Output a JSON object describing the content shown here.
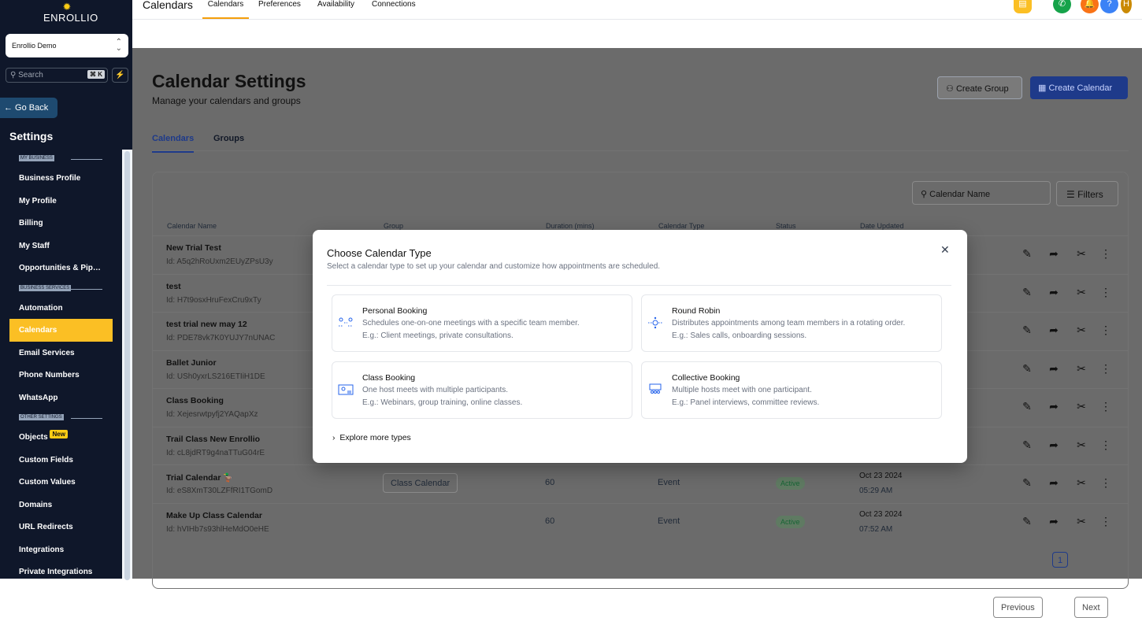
{
  "sidebar": {
    "brand": "ENROLLIO",
    "account": "Enrollio Demo",
    "search_placeholder": "Search",
    "search_kbd": "⌘ K",
    "go_back": "← Go Back",
    "title": "Settings",
    "sections": [
      {
        "label": "MY BUSINESS",
        "items": [
          {
            "label": "Business Profile"
          },
          {
            "label": "My Profile"
          },
          {
            "label": "Billing"
          },
          {
            "label": "My Staff"
          },
          {
            "label": "Opportunities & Pipe..."
          }
        ]
      },
      {
        "label": "BUSINESS SERVICES",
        "items": [
          {
            "label": "Automation"
          },
          {
            "label": "Calendars",
            "active": true
          },
          {
            "label": "Email Services"
          },
          {
            "label": "Phone Numbers"
          },
          {
            "label": "WhatsApp"
          }
        ]
      },
      {
        "label": "OTHER SETTINGS",
        "items": [
          {
            "label": "Objects",
            "badge": "New"
          },
          {
            "label": "Custom Fields"
          },
          {
            "label": "Custom Values"
          },
          {
            "label": "Domains"
          },
          {
            "label": "URL Redirects"
          },
          {
            "label": "Integrations"
          },
          {
            "label": "Private Integrations"
          }
        ]
      }
    ]
  },
  "topbar": {
    "title": "Calendars",
    "tabs": [
      "Calendars",
      "Preferences",
      "Availability",
      "Connections"
    ],
    "active_tab": "Calendars"
  },
  "page": {
    "title": "Calendar Settings",
    "subtitle": "Manage your calendars and groups",
    "create_group": "Create Group",
    "create_calendar": "Create Calendar",
    "tabs": [
      "Calendars",
      "Groups"
    ],
    "search_placeholder": "Calendar Name",
    "filters": "Filters"
  },
  "table": {
    "columns": [
      "Calendar Name",
      "Group",
      "Duration (mins)",
      "Calendar Type",
      "Status",
      "Date Updated"
    ],
    "rows": [
      {
        "name": "New Trial Test",
        "id": "Id: A5q2hRoUxm2EUyZPsU3y"
      },
      {
        "name": "test",
        "id": "Id: H7t9osxHruFexCru9xTy"
      },
      {
        "name": "test trial new may 12",
        "id": "Id: PDE78vk7K0YUJY7nUNAC"
      },
      {
        "name": "Ballet Junior",
        "id": "Id: USh0yxrLS216ETIiH1DE"
      },
      {
        "name": "Class Booking",
        "id": "Id: Xejesrwtpyfj2YAQapXz"
      },
      {
        "name": "Trail Class New Enrollio",
        "id": "Id: cL8jdRT9g4naTTuG04rE"
      },
      {
        "name": "Trial Calendar 🦆",
        "id": "Id: eS8XmT30LZFfRI1TGomD",
        "group": "Class Calendar",
        "duration": "60",
        "type": "Event",
        "status": "Active",
        "date": "Oct 23 2024",
        "time": "05:29 AM"
      },
      {
        "name": "Make Up Class Calendar",
        "id": "Id: hVIHb7s93hlHeMdO0eHE",
        "duration": "60",
        "type": "Event",
        "status": "Active",
        "date": "Oct 23 2024",
        "time": "07:52 AM"
      }
    ]
  },
  "pagination": {
    "previous": "Previous",
    "page": "1",
    "next": "Next"
  },
  "modal": {
    "title": "Choose Calendar Type",
    "subtitle": "Select a calendar type to set up your calendar and customize how appointments are scheduled.",
    "options": [
      {
        "title": "Personal Booking",
        "desc": "Schedules one-on-one meetings with a specific team member.",
        "example": "E.g.: Client meetings, private consultations."
      },
      {
        "title": "Round Robin",
        "desc": "Distributes appointments among team members in a rotating order.",
        "example": "E.g.: Sales calls, onboarding sessions."
      },
      {
        "title": "Class Booking",
        "desc": "One host meets with multiple participants.",
        "example": "E.g.: Webinars, group training, online classes."
      },
      {
        "title": "Collective Booking",
        "desc": "Multiple hosts meet with one participant.",
        "example": "E.g.: Panel interviews, committee reviews."
      }
    ],
    "explore": "Explore more types"
  },
  "colors": {
    "accent": "#1e40af",
    "active_nav": "#fbbf24",
    "sidebar_bg": "#0f172a"
  }
}
